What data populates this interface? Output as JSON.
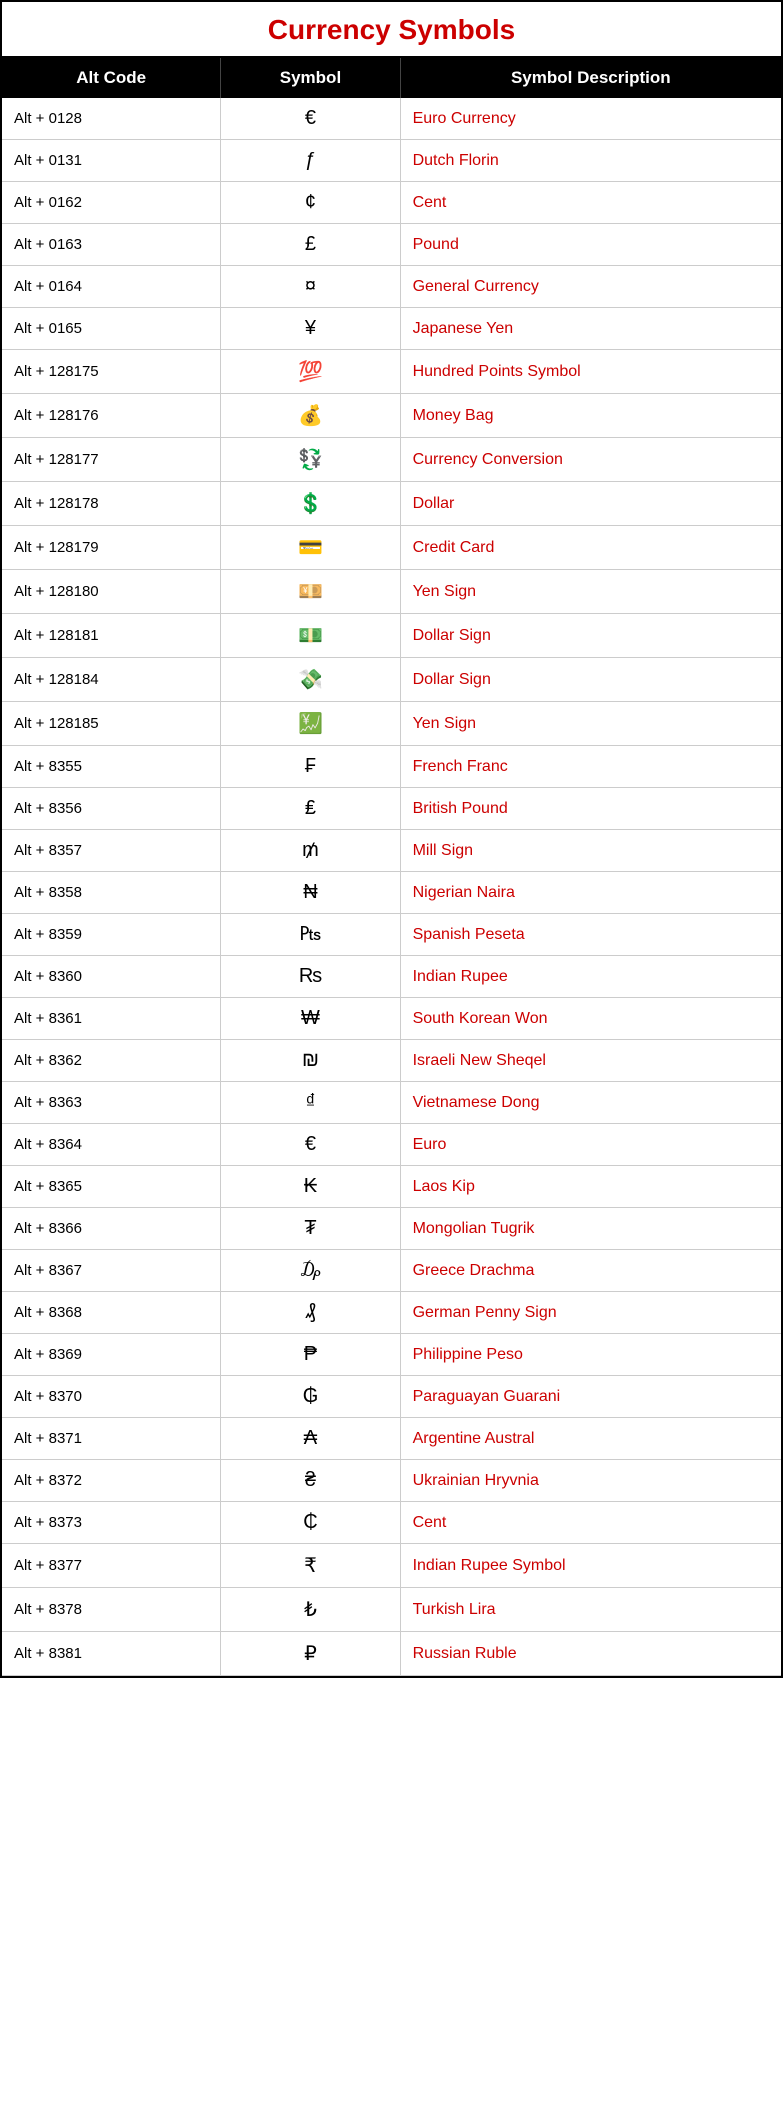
{
  "title": "Currency Symbols",
  "headers": [
    "Alt Code",
    "Symbol",
    "Symbol Description"
  ],
  "rows": [
    {
      "alt": "Alt + 0128",
      "symbol": "€",
      "desc": "Euro Currency"
    },
    {
      "alt": "Alt + 0131",
      "symbol": "ƒ",
      "desc": "Dutch Florin"
    },
    {
      "alt": "Alt + 0162",
      "symbol": "¢",
      "desc": "Cent"
    },
    {
      "alt": "Alt + 0163",
      "symbol": "£",
      "desc": "Pound"
    },
    {
      "alt": "Alt + 0164",
      "symbol": "¤",
      "desc": "General Currency"
    },
    {
      "alt": "Alt + 0165",
      "symbol": "¥",
      "desc": "Japanese Yen"
    },
    {
      "alt": "Alt + 128175",
      "symbol": "💯",
      "desc": "Hundred Points Symbol"
    },
    {
      "alt": "Alt + 128176",
      "symbol": "💰",
      "desc": "Money Bag"
    },
    {
      "alt": "Alt + 128177",
      "symbol": "💱",
      "desc": "Currency Conversion"
    },
    {
      "alt": "Alt + 128178",
      "symbol": "💲",
      "desc": "Dollar"
    },
    {
      "alt": "Alt + 128179",
      "symbol": "💳",
      "desc": "Credit Card"
    },
    {
      "alt": "Alt + 128180",
      "symbol": "💴",
      "desc": "Yen Sign"
    },
    {
      "alt": "Alt + 128181",
      "symbol": "💵",
      "desc": "Dollar Sign"
    },
    {
      "alt": "Alt + 128184",
      "symbol": "💸",
      "desc": "Dollar Sign"
    },
    {
      "alt": "Alt + 128185",
      "symbol": "💹",
      "desc": "Yen Sign"
    },
    {
      "alt": "Alt + 8355",
      "symbol": "₣",
      "desc": "French Franc"
    },
    {
      "alt": "Alt + 8356",
      "symbol": "₤",
      "desc": "British Pound"
    },
    {
      "alt": "Alt + 8357",
      "symbol": "₥",
      "desc": "Mill Sign"
    },
    {
      "alt": "Alt + 8358",
      "symbol": "₦",
      "desc": "Nigerian Naira"
    },
    {
      "alt": "Alt + 8359",
      "symbol": "₧",
      "desc": "Spanish Peseta"
    },
    {
      "alt": "Alt + 8360",
      "symbol": "₨",
      "desc": "Indian Rupee"
    },
    {
      "alt": "Alt + 8361",
      "symbol": "₩",
      "desc": "South Korean Won"
    },
    {
      "alt": "Alt + 8362",
      "symbol": "₪",
      "desc": "Israeli New Sheqel"
    },
    {
      "alt": "Alt + 8363",
      "symbol": "₫",
      "desc": "Vietnamese Dong"
    },
    {
      "alt": "Alt + 8364",
      "symbol": "€",
      "desc": "Euro"
    },
    {
      "alt": "Alt + 8365",
      "symbol": "₭",
      "desc": "Laos Kip"
    },
    {
      "alt": "Alt + 8366",
      "symbol": "₮",
      "desc": "Mongolian Tugrik"
    },
    {
      "alt": "Alt + 8367",
      "symbol": "₯",
      "desc": "Greece Drachma"
    },
    {
      "alt": "Alt + 8368",
      "symbol": "₰",
      "desc": "German Penny  Sign"
    },
    {
      "alt": "Alt + 8369",
      "symbol": "₱",
      "desc": "Philippine Peso"
    },
    {
      "alt": "Alt + 8370",
      "symbol": "₲",
      "desc": "Paraguayan Guarani"
    },
    {
      "alt": "Alt + 8371",
      "symbol": "₳",
      "desc": "Argentine Austral"
    },
    {
      "alt": "Alt + 8372",
      "symbol": "₴",
      "desc": "Ukrainian Hryvnia"
    },
    {
      "alt": "Alt + 8373",
      "symbol": "₵",
      "desc": "Cent"
    },
    {
      "alt": "Alt + 8377",
      "symbol": "₹",
      "desc": "Indian Rupee Symbol"
    },
    {
      "alt": "Alt + 8378",
      "symbol": "₺",
      "desc": "Turkish Lira"
    },
    {
      "alt": "Alt + 8381",
      "symbol": "₽",
      "desc": "Russian Ruble"
    }
  ]
}
